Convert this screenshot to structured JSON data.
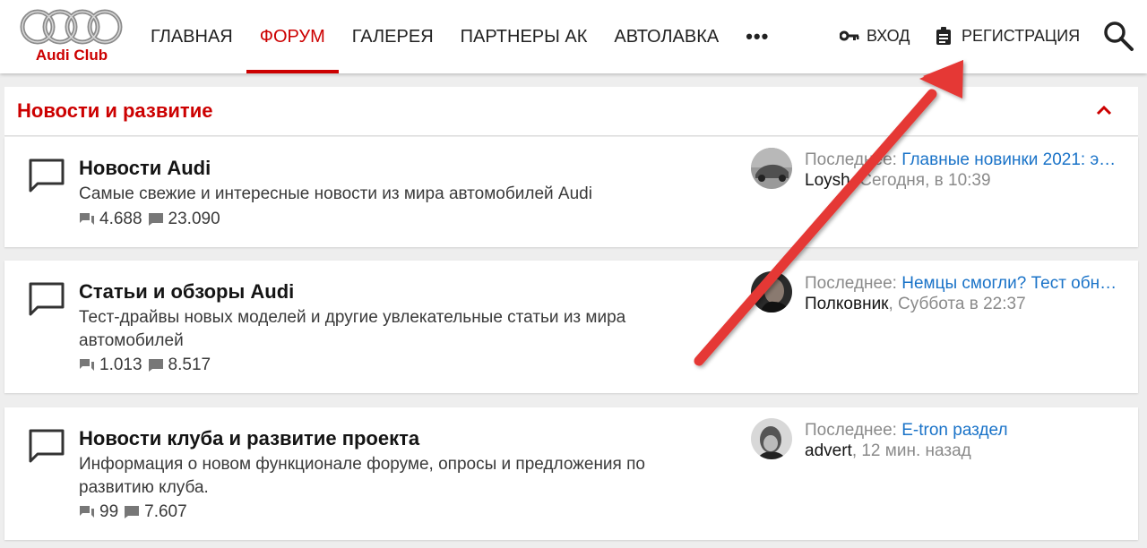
{
  "header": {
    "logo_text": "Audi Club",
    "nav": [
      {
        "label": "Главная",
        "active": false
      },
      {
        "label": "Форум",
        "active": true
      },
      {
        "label": "Галерея",
        "active": false
      },
      {
        "label": "Партнеры АК",
        "active": false
      },
      {
        "label": "Автолавка",
        "active": false
      }
    ],
    "more_label": "•••",
    "login_label": "Вход",
    "register_label": "Регистрация",
    "icons": {
      "login": "key-icon",
      "register": "clipboard-icon",
      "search": "search-icon",
      "more": "more-dots-icon"
    }
  },
  "section": {
    "title": "Новости и развитие",
    "collapse_icon": "chevron-up-icon"
  },
  "forums": [
    {
      "title": "Новости Audi",
      "description": "Самые свежие и интересные новости из мира автомобилей Audi",
      "threads": "4.688",
      "messages": "23.090",
      "last_label": "Последнее:",
      "last_title": "Главные новинки 2021: э…",
      "last_user": "Loysh",
      "last_time": ", Сегодня, в 10:39"
    },
    {
      "title": "Статьи и обзоры Audi",
      "description": "Тест-драйвы новых моделей и другие увлекательные статьи из мира автомобилей",
      "threads": "1.013",
      "messages": "8.517",
      "last_label": "Последнее:",
      "last_title": "Немцы смогли? Тест обн…",
      "last_user": "Полковник",
      "last_time": ", Суббота в 22:37"
    },
    {
      "title": "Новости клуба и развитие проекта",
      "description": "Информация о новом функционале форуме, опросы и предложения по развитию клуба.",
      "threads": "99",
      "messages": "7.607",
      "last_label": "Последнее:",
      "last_title": "E-tron раздел",
      "last_user": "advert",
      "last_time": ", 12 мин. назад"
    }
  ],
  "colors": {
    "accent": "#cc0000",
    "link": "#1a73c8",
    "arrow": "#e53935"
  }
}
